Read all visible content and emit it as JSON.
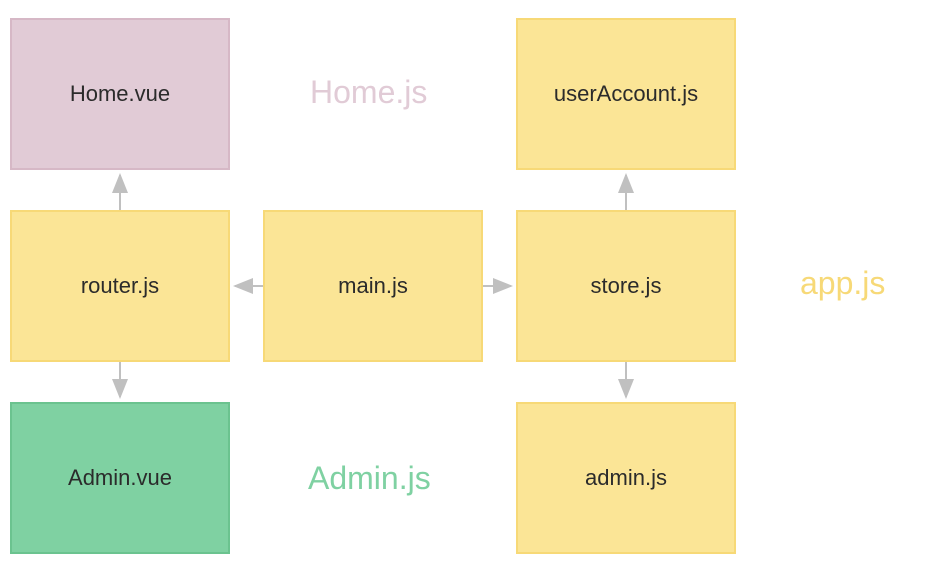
{
  "boxes": {
    "homeVue": "Home.vue",
    "userAccountJs": "userAccount.js",
    "routerJs": "router.js",
    "mainJs": "main.js",
    "storeJs": "store.js",
    "adminVue": "Admin.vue",
    "adminJs": "admin.js"
  },
  "labels": {
    "home": "Home.js",
    "admin": "Admin.js",
    "app": "app.js"
  },
  "colors": {
    "yellowFill": "#fbe596",
    "yellowStroke": "#f7d977",
    "pinkFill": "#e1cbd6",
    "pinkStroke": "#d6b8c6",
    "greenFill": "#7fd1a2",
    "greenStroke": "#6bc38f",
    "arrowStroke": "#c0c0c0"
  },
  "arrows": [
    {
      "from": "routerJs",
      "to": "homeVue",
      "dir": "up"
    },
    {
      "from": "routerJs",
      "to": "adminVue",
      "dir": "down"
    },
    {
      "from": "mainJs",
      "to": "routerJs",
      "dir": "left"
    },
    {
      "from": "mainJs",
      "to": "storeJs",
      "dir": "right"
    },
    {
      "from": "storeJs",
      "to": "userAccountJs",
      "dir": "up"
    },
    {
      "from": "storeJs",
      "to": "adminJs",
      "dir": "down"
    }
  ]
}
